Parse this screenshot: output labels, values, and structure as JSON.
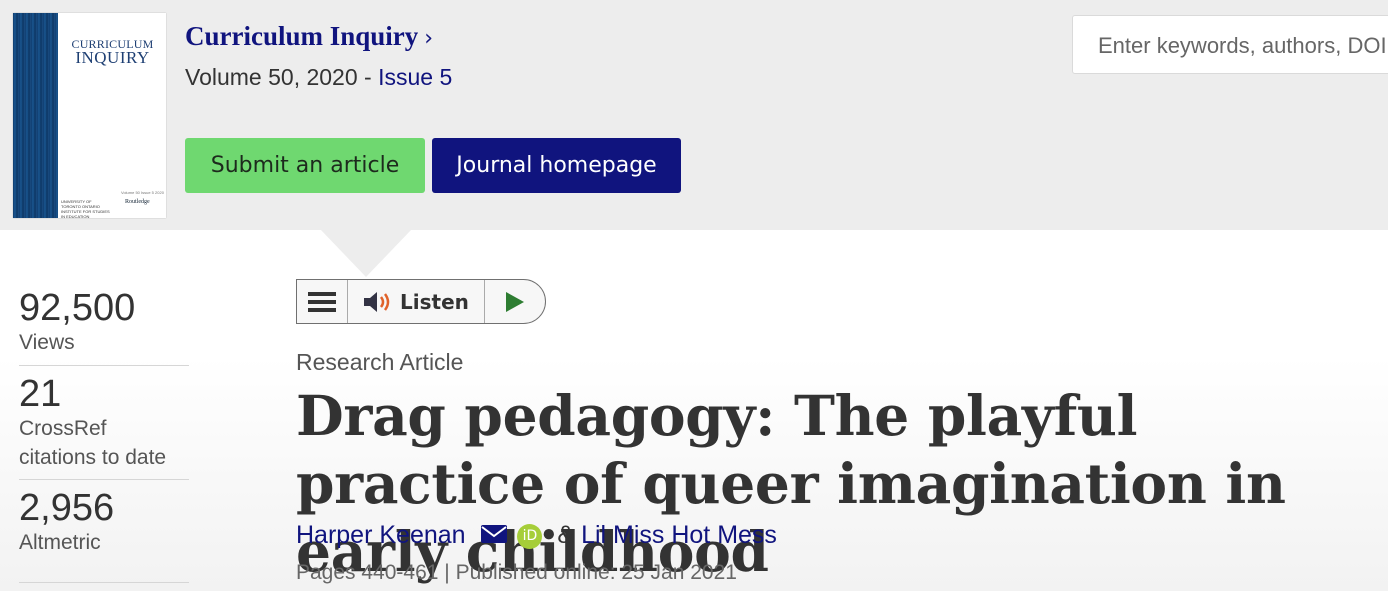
{
  "journal": {
    "cover": {
      "title_line1": "CURRICULUM",
      "title_line2": "INQUIRY",
      "volume_text": "Volume 50 Issue 5 2020",
      "publisher_left": "UNIVERSITY OF TORONTO\nONTARIO INSTITUTE\nFOR STUDIES IN EDUCATION",
      "publisher_right": "Routledge"
    },
    "title": "Curriculum Inquiry",
    "volume_text": "Volume 50, 2020 - ",
    "issue_link": "Issue 5",
    "submit_label": "Submit an article",
    "homepage_label": "Journal homepage"
  },
  "search": {
    "placeholder": "Enter keywords, authors, DOI, etc."
  },
  "metrics": [
    {
      "value": "92,500",
      "label": "Views"
    },
    {
      "value": "21",
      "label": "CrossRef citations to date"
    },
    {
      "value": "2,956",
      "label": "Altmetric"
    }
  ],
  "listen": {
    "label": "Listen"
  },
  "article": {
    "type": "Research Article",
    "title": "Drag pedagogy: The playful practice of queer imagination in early childhood",
    "author1": "Harper Keenan",
    "orcid_text": "iD",
    "separator": "&",
    "author2": "Lil Miss Hot Mess",
    "pages": "Pages 440-461",
    "published": "Published online: 25 Jan 2021"
  },
  "colors": {
    "header_bg": "#ededed",
    "link_navy": "#10147e",
    "submit_green": "#6fd870",
    "orcid_green": "#a6ce39"
  }
}
